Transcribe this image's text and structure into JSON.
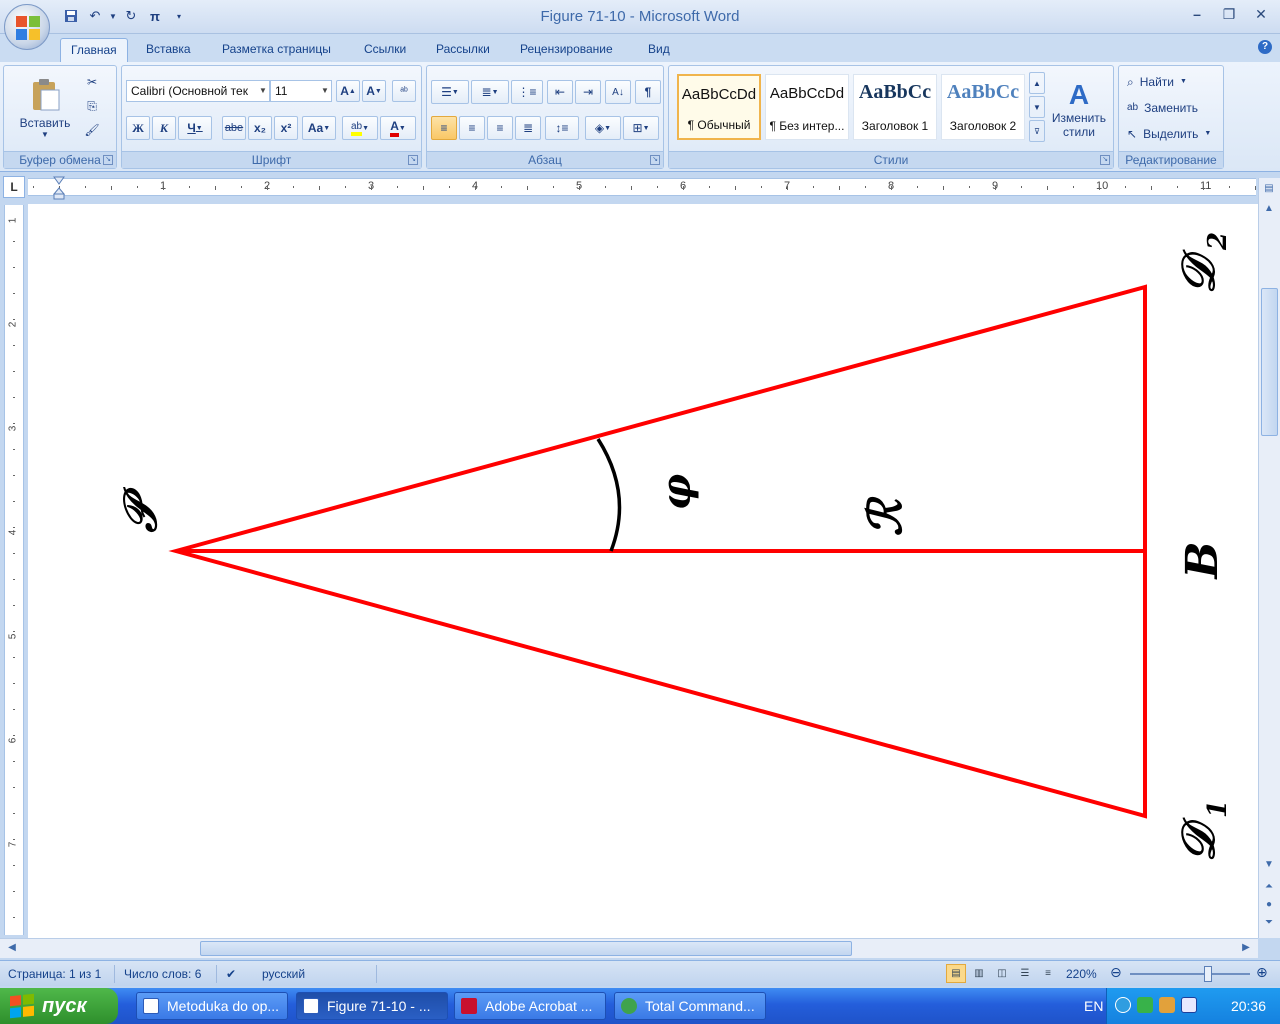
{
  "window": {
    "title": "Figure 71-10 - Microsoft Word"
  },
  "ribbon": {
    "tabs": [
      "Главная",
      "Вставка",
      "Разметка страницы",
      "Ссылки",
      "Рассылки",
      "Рецензирование",
      "Вид"
    ],
    "active_tab": "Главная",
    "clipboard": {
      "paste_label": "Вставить",
      "group_label": "Буфер обмена"
    },
    "font": {
      "name": "Calibri (Основной тек",
      "size": "11",
      "group_label": "Шрифт"
    },
    "paragraph": {
      "group_label": "Абзац"
    },
    "styles": {
      "group_label": "Стили",
      "tiles": [
        {
          "sample": "AaBbCcDd",
          "name": "¶ Обычный"
        },
        {
          "sample": "AaBbCcDd",
          "name": "¶ Без интер..."
        },
        {
          "sample": "AaBbCc",
          "name": "Заголовок 1"
        },
        {
          "sample": "AaBbCc",
          "name": "Заголовок 2"
        }
      ],
      "change_styles_line1": "Изменить",
      "change_styles_line2": "стили"
    },
    "editing": {
      "group_label": "Редактирование",
      "find": "Найти",
      "replace": "Заменить",
      "select": "Выделить"
    }
  },
  "ruler": {
    "h_numbers": [
      "1",
      "2",
      "3",
      "4",
      "5",
      "6",
      "7",
      "8",
      "9",
      "10",
      "11"
    ],
    "v_numbers": [
      "1",
      "2",
      "3",
      "4",
      "5",
      "6",
      "7"
    ]
  },
  "document": {
    "labels": {
      "P": "𝒫",
      "phi": "φ",
      "R": "ℛ",
      "B": "B",
      "D2": "𝒟",
      "D2_sub": "2",
      "D1": "𝒟",
      "D1_sub": "1"
    },
    "line_color": "#ff0000"
  },
  "status": {
    "page": "Страница: 1 из 1",
    "words": "Число слов: 6",
    "language": "русский",
    "zoom": "220%"
  },
  "taskbar": {
    "start": "пуск",
    "tasks": [
      "Metoduka do op...",
      "Figure 71-10 - ...",
      "Adobe Acrobat ...",
      "Total Command..."
    ],
    "lang": "EN",
    "clock": "20:36"
  }
}
